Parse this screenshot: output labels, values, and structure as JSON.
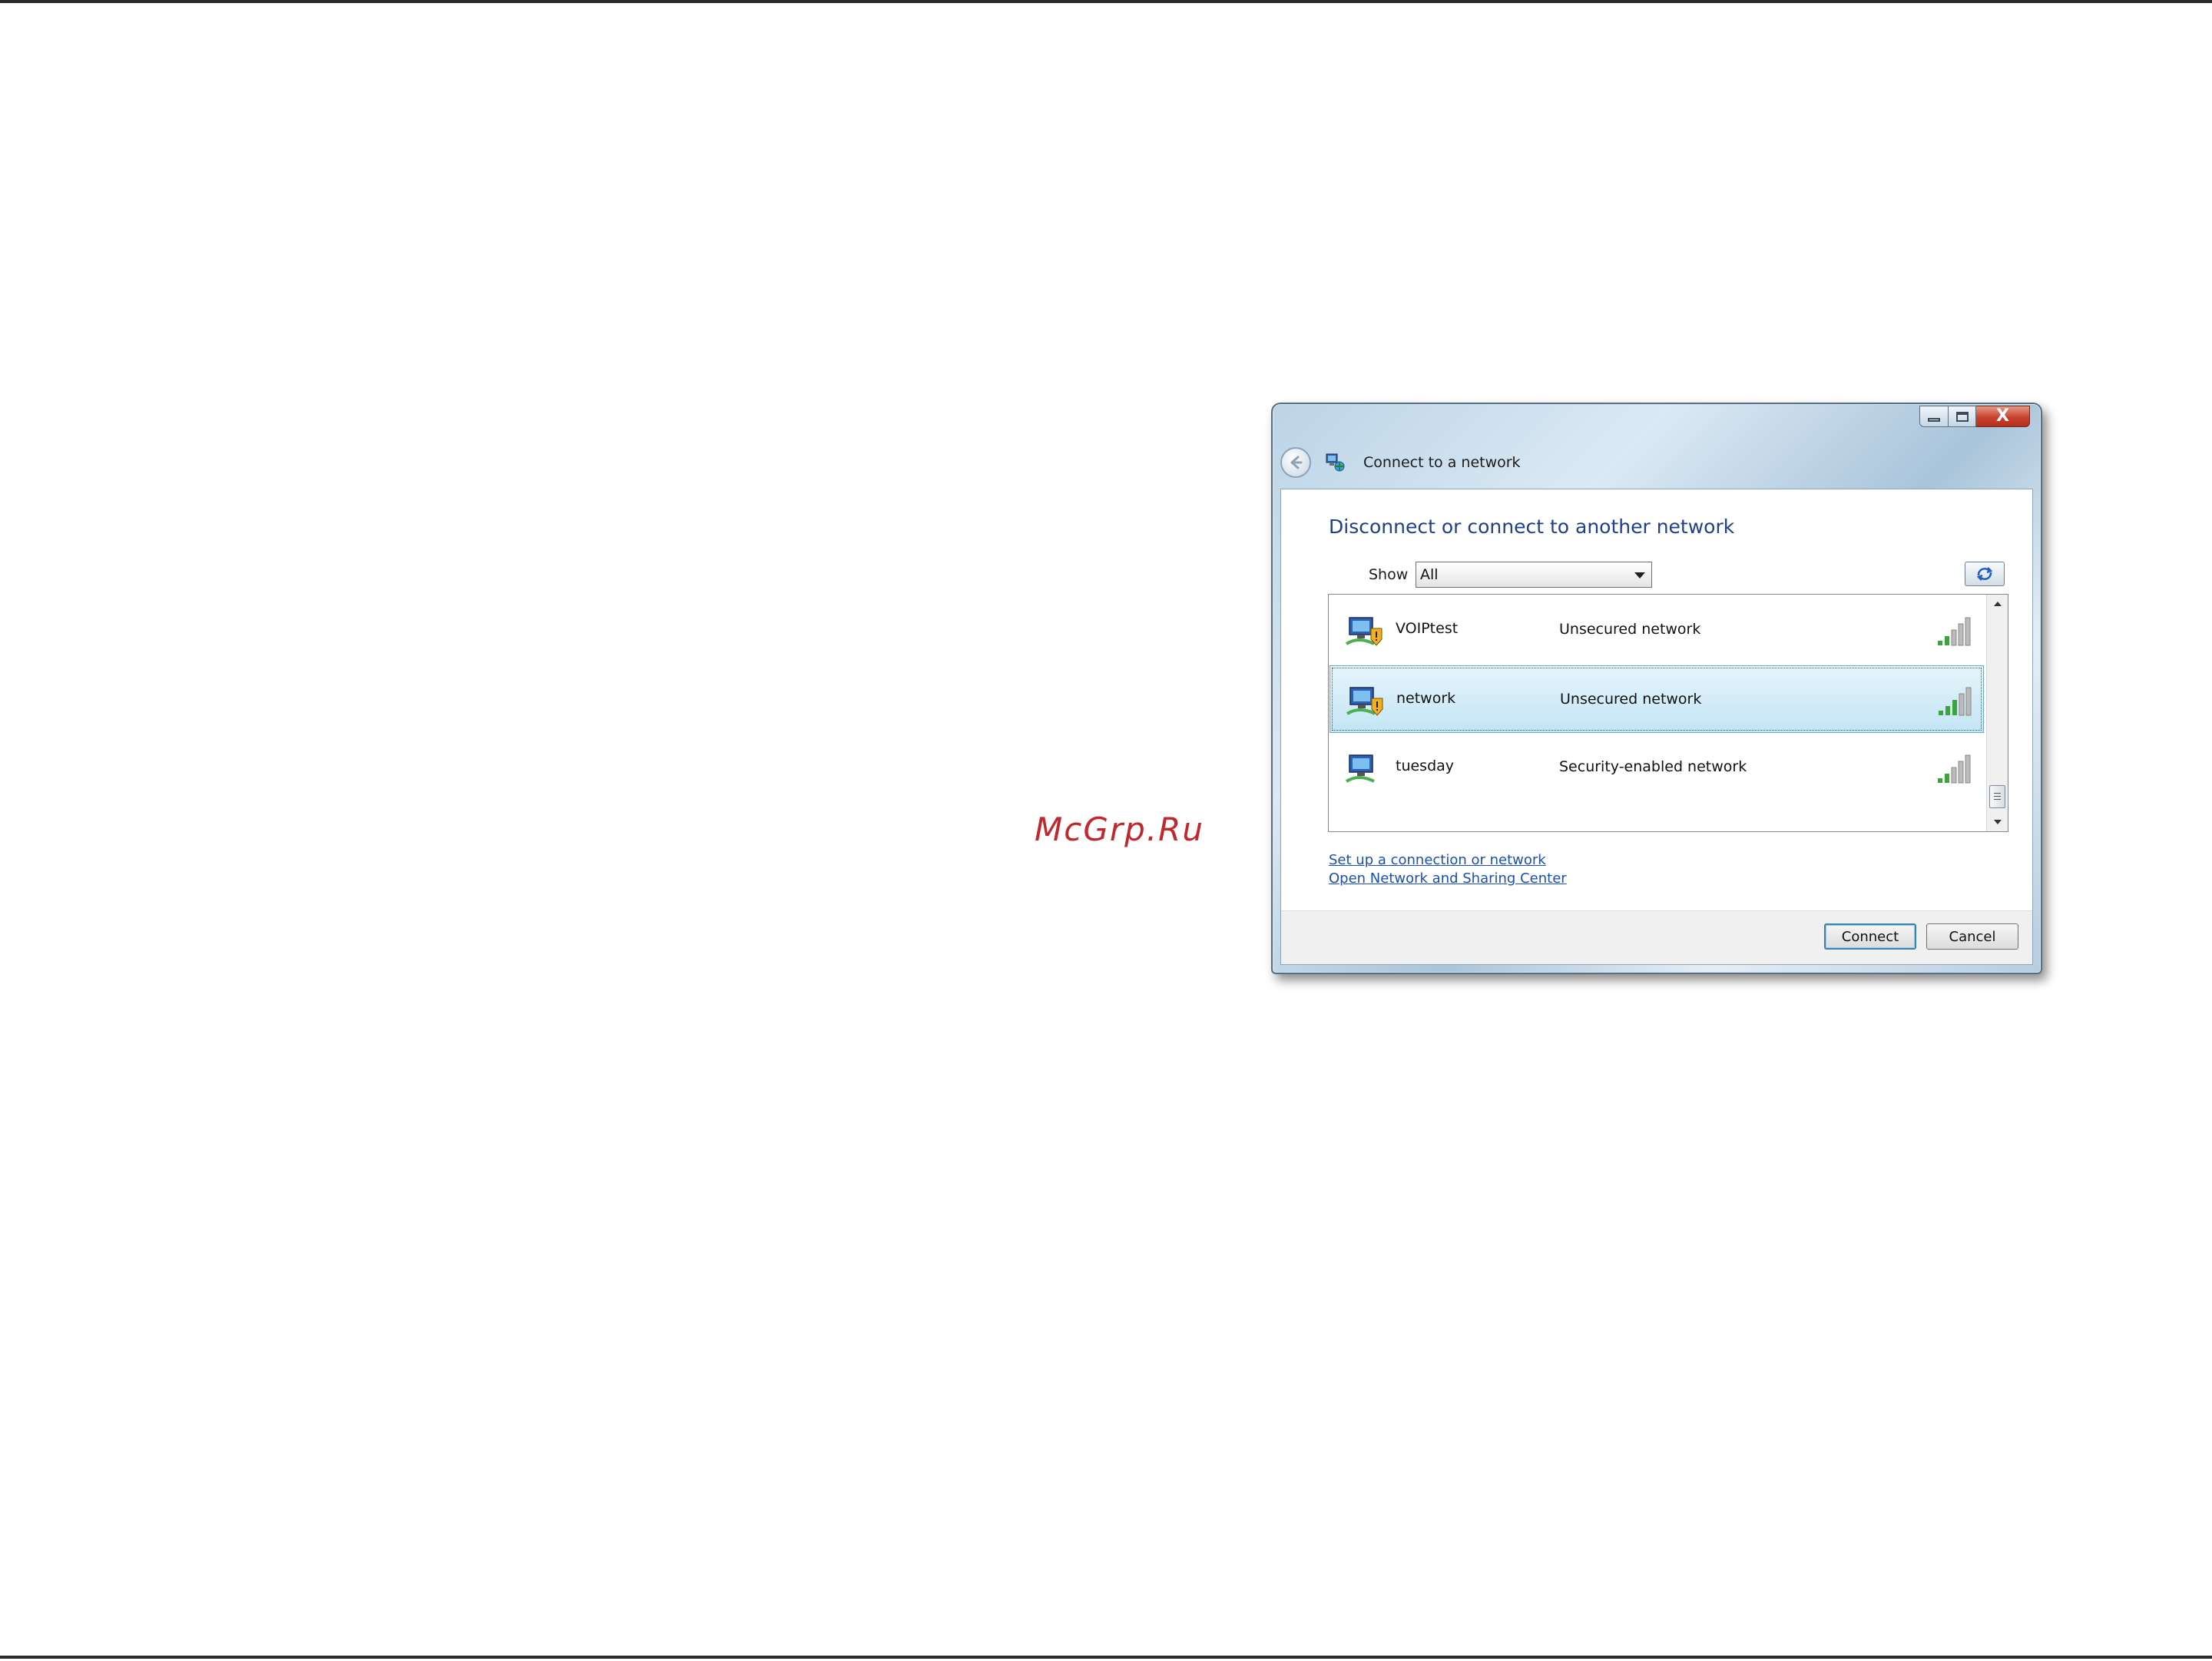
{
  "watermark": "McGrp.Ru",
  "window": {
    "title": "Connect to a network",
    "caption_buttons": {
      "minimize_icon": "minimize-icon",
      "maximize_icon": "maximize-icon",
      "close_glyph": "X"
    }
  },
  "content": {
    "heading": "Disconnect or connect to another network",
    "show_label": "Show",
    "show_value": "All",
    "networks": [
      {
        "name": "VOIPtest",
        "status": "Unsecured network",
        "signal_bars": 5,
        "secured": false,
        "selected": false
      },
      {
        "name": "network",
        "status": "Unsecured network",
        "signal_bars": 5,
        "secured": false,
        "selected": true
      },
      {
        "name": "tuesday",
        "status": "Security-enabled network",
        "signal_bars": 5,
        "secured": true,
        "selected": false
      }
    ],
    "links": {
      "setup": "Set up a connection or network",
      "sharing_center": "Open Network and Sharing Center"
    }
  },
  "footer": {
    "connect_label": "Connect",
    "cancel_label": "Cancel"
  },
  "colors": {
    "heading": "#1e3f8c",
    "link": "#1a4fb3",
    "selection": "#c3e5f5",
    "watermark": "#c0282d",
    "signal": "#3aa63a"
  }
}
